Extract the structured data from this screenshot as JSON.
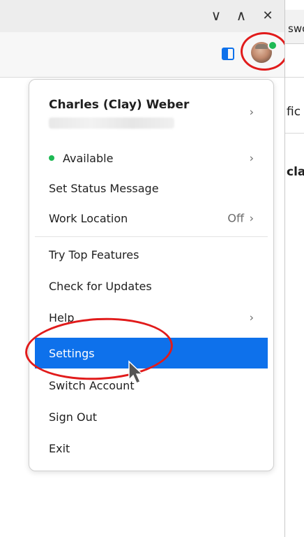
{
  "window_controls": {
    "minimize_glyph": "∨",
    "maximize_glyph": "∧",
    "close_glyph": "✕"
  },
  "right_pane": {
    "tab_text": "swo",
    "line1": "fic",
    "line2": "cla"
  },
  "user": {
    "name": "Charles (Clay) Weber",
    "email": "",
    "presence_color": "#1db954"
  },
  "menu": {
    "status": {
      "label": "Available"
    },
    "set_status": {
      "label": "Set Status Message"
    },
    "work_location": {
      "label": "Work Location",
      "value": "Off"
    },
    "try_features": {
      "label": "Try Top Features"
    },
    "check_updates": {
      "label": "Check for Updates"
    },
    "help": {
      "label": "Help"
    },
    "settings": {
      "label": "Settings"
    },
    "switch_account": {
      "label": "Switch Account"
    },
    "sign_out": {
      "label": "Sign Out"
    },
    "exit": {
      "label": "Exit"
    }
  },
  "chevron_glyph": "›",
  "colors": {
    "accent": "#0e71eb",
    "annotation": "#e11b1b",
    "available": "#1db954"
  }
}
